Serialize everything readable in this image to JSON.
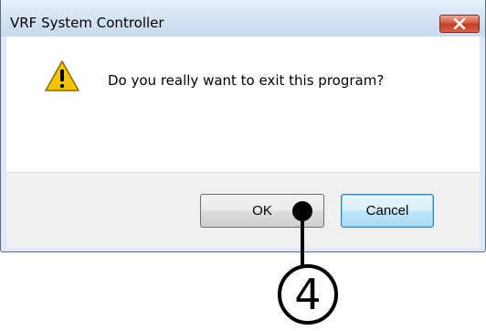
{
  "window": {
    "title": "VRF System Controller"
  },
  "dialog": {
    "message": "Do you really want to exit this program?"
  },
  "buttons": {
    "ok_label": "OK",
    "cancel_label": "Cancel"
  },
  "annotation": {
    "step_number": "4"
  },
  "icons": {
    "warning": "warning-icon",
    "close": "close-icon"
  },
  "colors": {
    "close_button": "#c8442a",
    "warning_fill": "#f5c400",
    "callout": "#000000"
  }
}
